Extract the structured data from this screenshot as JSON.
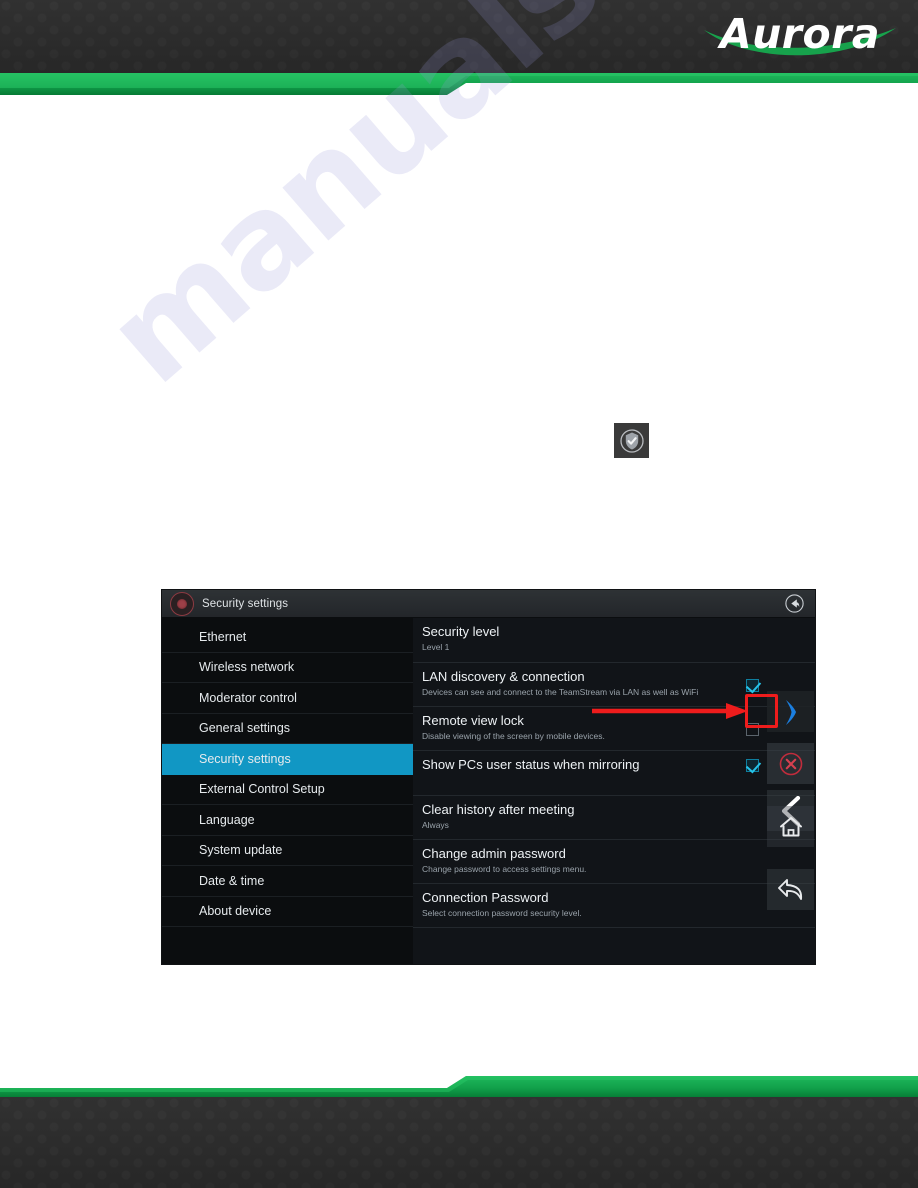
{
  "page": {
    "brand": "Aurora",
    "watermark": "manualshive.com"
  },
  "device_ui": {
    "title_bar": {
      "title": "Security settings",
      "app_icon": "aurora-badge-icon",
      "back_icon": "circular-back-arrow-icon"
    },
    "menu": {
      "items": [
        {
          "label": "Ethernet",
          "selected": false
        },
        {
          "label": "Wireless network",
          "selected": false
        },
        {
          "label": "Moderator control",
          "selected": false
        },
        {
          "label": "General settings",
          "selected": false
        },
        {
          "label": "Security settings",
          "selected": true
        },
        {
          "label": "External Control Setup",
          "selected": false
        },
        {
          "label": "Language",
          "selected": false
        },
        {
          "label": "System update",
          "selected": false
        },
        {
          "label": "Date & time",
          "selected": false
        },
        {
          "label": "About device",
          "selected": false
        }
      ]
    },
    "settings": {
      "rows": [
        {
          "title": "Security level",
          "subtitle": "Level 1",
          "control": "none",
          "checked": null
        },
        {
          "title": "LAN discovery & connection",
          "subtitle": "Devices can see and connect to the TeamStream via LAN as well as WiFi",
          "control": "checkbox",
          "checked": true
        },
        {
          "title": "Remote view lock",
          "subtitle": "Disable viewing of the screen by mobile devices.",
          "control": "checkbox",
          "checked": false
        },
        {
          "title": "Show PCs user status when mirroring",
          "subtitle": "",
          "control": "checkbox",
          "checked": true
        },
        {
          "title": "Clear history after meeting",
          "subtitle": "Always",
          "control": "none",
          "checked": null
        },
        {
          "title": "Change admin password",
          "subtitle": "Change password to access settings menu.",
          "control": "none",
          "checked": null
        },
        {
          "title": "Connection Password",
          "subtitle": "Select connection password security level.",
          "control": "none",
          "checked": null
        }
      ]
    },
    "nav_overlay": {
      "buttons": [
        {
          "icon": "chevron-right-icon",
          "color": "#1b7fe0"
        },
        {
          "icon": "close-circle-icon",
          "color": "#c12c3c"
        },
        {
          "icon": "chevron-left-back-icon",
          "color": "#ffffff"
        },
        {
          "icon": "home-icon",
          "color": "#e8eaec"
        },
        {
          "icon": "reply-arrow-icon",
          "color": "#e8eaec"
        }
      ]
    }
  },
  "annotation": {
    "type": "callout-arrow-and-box",
    "color": "#ee1c1c",
    "target": "LAN discovery & connection checkbox"
  },
  "floating_icon": {
    "name": "shield-check-icon",
    "background": "#3a3a3a"
  },
  "colors": {
    "brand_green": "#10a04a",
    "accent_blue": "#1197c4",
    "panel_dark": "#0b0d0f",
    "header_dark": "#2c2c2c",
    "annotation_red": "#ee1c1c",
    "check_cyan": "#27c3e8"
  }
}
